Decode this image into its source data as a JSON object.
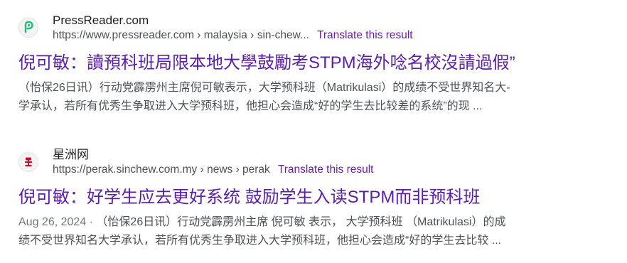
{
  "results": [
    {
      "site_name": "PressReader.com",
      "url": "https://www.pressreader.com › malaysia › sin-chew...",
      "translate_label": "Translate this result",
      "title": "倪可敏：讀預科班局限本地大學鼓勵考STPM海外唸名校沒請過假”",
      "date": "",
      "snippet_lines": [
        "（怡保26日讯）行动党霹雳州主席倪可敏表示，大学预科班（Matrikulasi）的成绩不受世界知名大-",
        "学承认，若所有优秀生争取进入大学预科班，他担心会造成“好的学生去比较差的系统”的现 ..."
      ],
      "favicon": "pressreader-logo-icon",
      "favicon_color": "#2bb673"
    },
    {
      "site_name": "星洲网",
      "url": "https://perak.sinchew.com.my › news › perak",
      "translate_label": "Translate this result",
      "title": "倪可敏：好学生应去更好系统 鼓励学生入读STPM而非预科班",
      "date": "Aug 26, 2024 · ",
      "snippet_lines": [
        "（怡保26日讯）行动党霹雳州主席 倪可敏 表示， 大学预科班 （Matrikulasi）的成",
        "绩不受世界知名大学承认，若所有优秀生争取进入大学预科班，他担心会造成“好的学生去比较 ..."
      ],
      "favicon": "sinchew-logo-icon",
      "favicon_color": "#c8102e"
    }
  ]
}
